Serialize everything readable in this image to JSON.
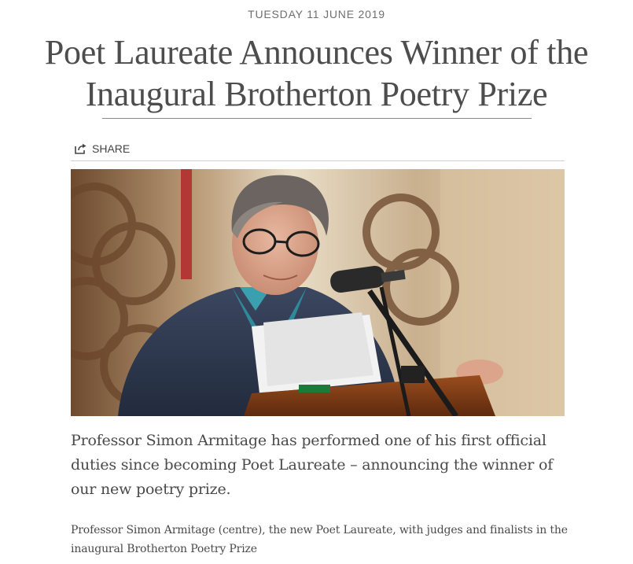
{
  "article": {
    "date": "TUESDAY 11 JUNE 2019",
    "title": "Poet Laureate Announces Winner of the Inaugural Brotherton Poetry Prize",
    "share_label": "SHARE",
    "lead": "Professor Simon Armitage has performed one of his first official duties since becoming Poet Laureate – announcing the winner of our new poetry prize.",
    "caption": "Professor Simon Armitage (centre), the new Poet Laureate, with judges and finalists in the inaugural Brotherton Poetry Prize"
  },
  "icons": {
    "share": "share-icon"
  },
  "colors": {
    "title": "#4d4d4d",
    "date": "#6f6f6f",
    "body_text": "#4a4a4a",
    "rule": "#8a8a8a"
  }
}
